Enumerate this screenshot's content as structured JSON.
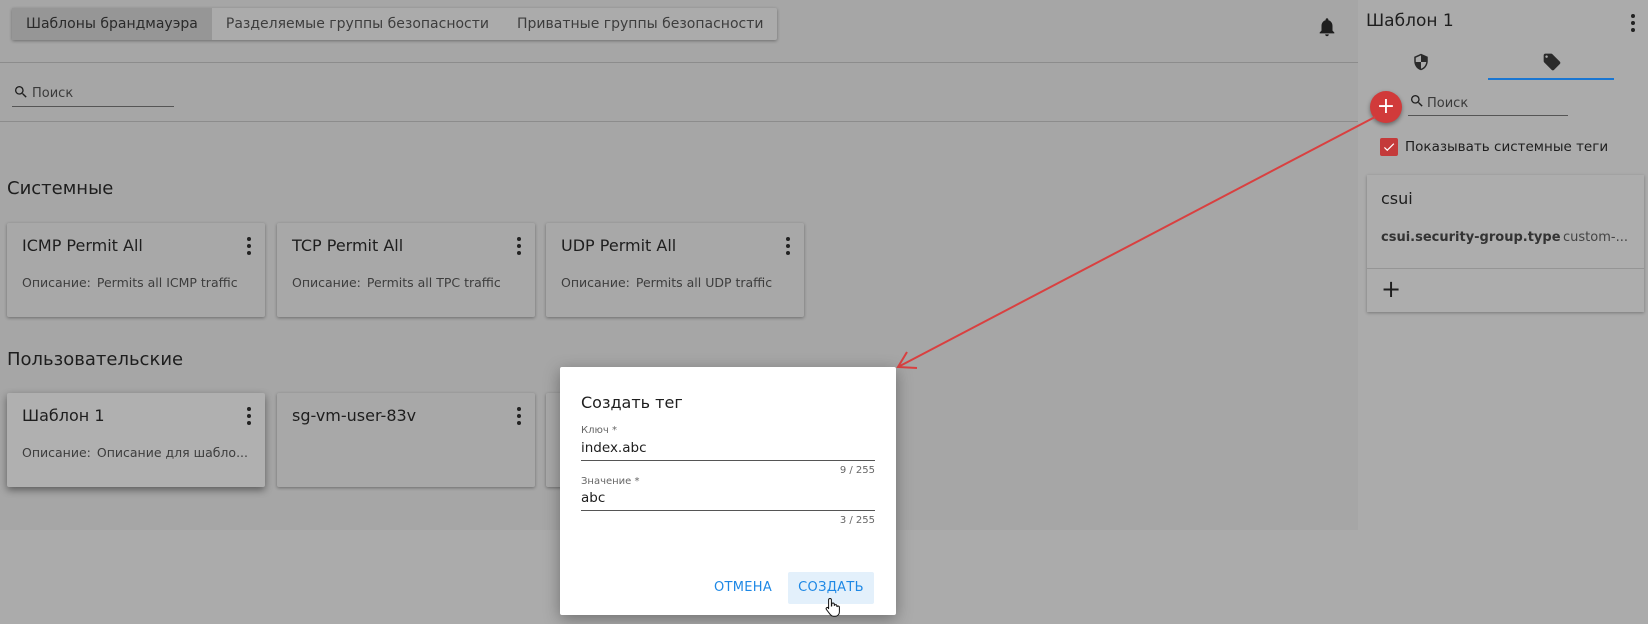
{
  "tabs": [
    {
      "label": "Шаблоны брандмауэра",
      "active": true
    },
    {
      "label": "Разделяемые группы безопасности",
      "active": false
    },
    {
      "label": "Приватные группы безопасности",
      "active": false
    }
  ],
  "search": {
    "placeholder": "Поиск"
  },
  "sections": {
    "system": "Системные",
    "user": "Пользовательские"
  },
  "desc_label": "Описание:",
  "system_cards": [
    {
      "title": "ICMP Permit All",
      "description": "Permits all ICMP traffic"
    },
    {
      "title": "TCP Permit All",
      "description": "Permits all TPC traffic"
    },
    {
      "title": "UDP Permit All",
      "description": "Permits all UDP traffic"
    }
  ],
  "user_cards": [
    {
      "title": "Шаблон 1",
      "description": "Описание для шабло..."
    },
    {
      "title": "sg-vm-user-83v",
      "description": ""
    }
  ],
  "sidebar": {
    "title": "Шаблон 1",
    "search_placeholder": "Поиск",
    "add_symbol": "+",
    "show_system_tags_label": "Показывать системные теги",
    "show_system_tags_checked": true,
    "tag_group": {
      "namespace": "csui",
      "key": "csui.security-group.type",
      "value": "custom-...",
      "add_symbol": "+"
    }
  },
  "dialog": {
    "title": "Создать тег",
    "key_label": "Ключ *",
    "key_value": "index.abc",
    "key_counter": "9 / 255",
    "value_label": "Значение *",
    "value_value": "abc",
    "value_counter": "3 / 255",
    "cancel_label": "ОТМЕНА",
    "create_label": "СОЗДАТЬ"
  },
  "colors": {
    "accent": "#1976d2",
    "fab": "#d13a3a",
    "annotation_arrow": "#d94040"
  }
}
